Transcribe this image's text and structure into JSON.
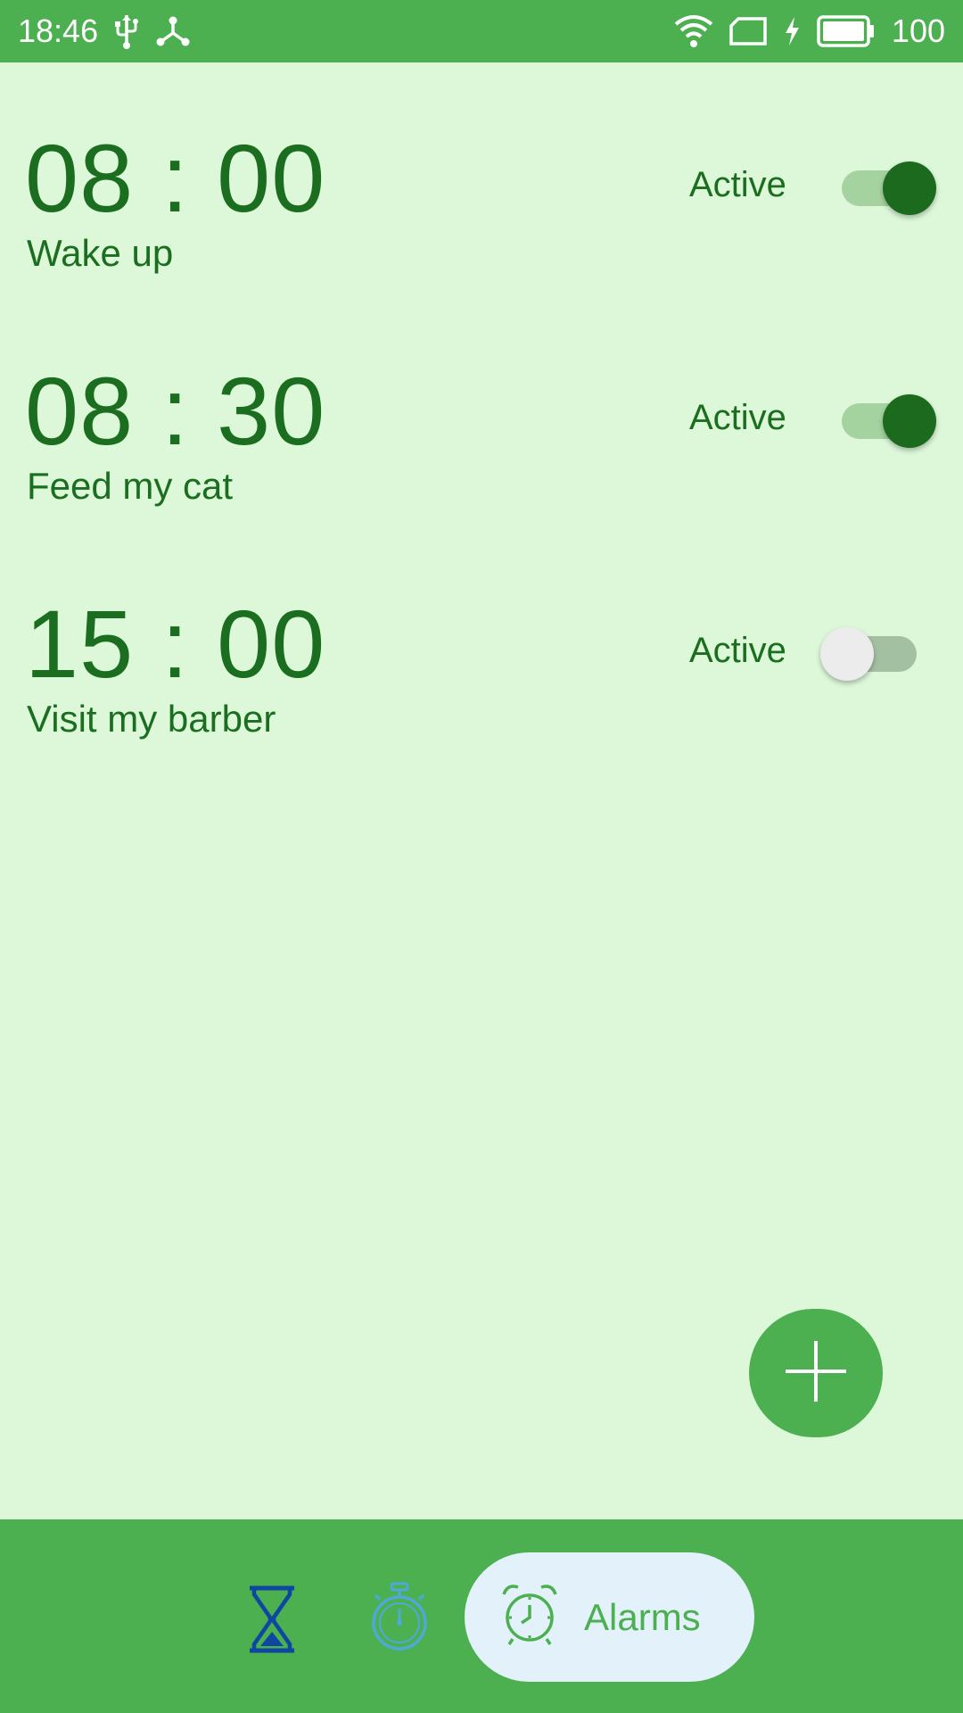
{
  "status_bar": {
    "time": "18:46",
    "battery_level": "100",
    "icons": [
      "usb-icon",
      "network-share-icon",
      "wifi-icon",
      "sim-card-icon",
      "charging-icon",
      "battery-icon"
    ]
  },
  "alarms": [
    {
      "time": "08 : 00",
      "label": "Wake up",
      "status_label": "Active",
      "enabled": true
    },
    {
      "time": "08 : 30",
      "label": "Feed my cat",
      "status_label": "Active",
      "enabled": true
    },
    {
      "time": "15 : 00",
      "label": "Visit my barber",
      "status_label": "Active",
      "enabled": false
    }
  ],
  "fab": {
    "icon": "plus-icon"
  },
  "bottom_nav": {
    "items": [
      {
        "icon": "hourglass-icon",
        "label": "",
        "selected": false
      },
      {
        "icon": "stopwatch-icon",
        "label": "",
        "selected": false
      },
      {
        "icon": "alarm-clock-icon",
        "label": "Alarms",
        "selected": true
      }
    ]
  },
  "colors": {
    "primary": "#4caf50",
    "background": "#dcf8d9",
    "text": "#1b6e1f",
    "toggle_on_thumb": "#1b6a1d",
    "nav_selected_bg": "#e3f1fb",
    "timer_icon": "#0d47a1",
    "stopwatch_icon": "#4fa9d8"
  }
}
